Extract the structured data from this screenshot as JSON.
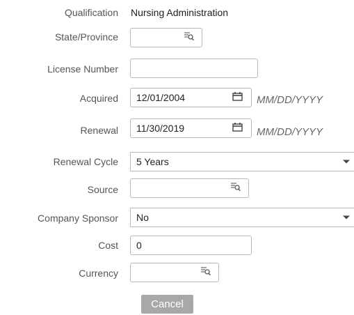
{
  "labels": {
    "qualification": "Qualification",
    "state_province": "State/Province",
    "license_number": "License Number",
    "acquired": "Acquired",
    "renewal": "Renewal",
    "renewal_cycle": "Renewal Cycle",
    "source": "Source",
    "company_sponsor": "Company Sponsor",
    "cost": "Cost",
    "currency": "Currency"
  },
  "values": {
    "qualification": "Nursing Administration",
    "state_province": "",
    "license_number": "",
    "acquired": "12/01/2004",
    "renewal": "11/30/2019",
    "renewal_cycle": "5 Years",
    "source": "",
    "company_sponsor": "No",
    "cost": "0",
    "currency": ""
  },
  "date_format_hint": "MM/DD/YYYY",
  "buttons": {
    "cancel": "Cancel"
  },
  "icons": {
    "lookup": "lookup-list-magnifier-icon",
    "calendar": "calendar-icon",
    "dropdown": "caret-down-icon"
  }
}
